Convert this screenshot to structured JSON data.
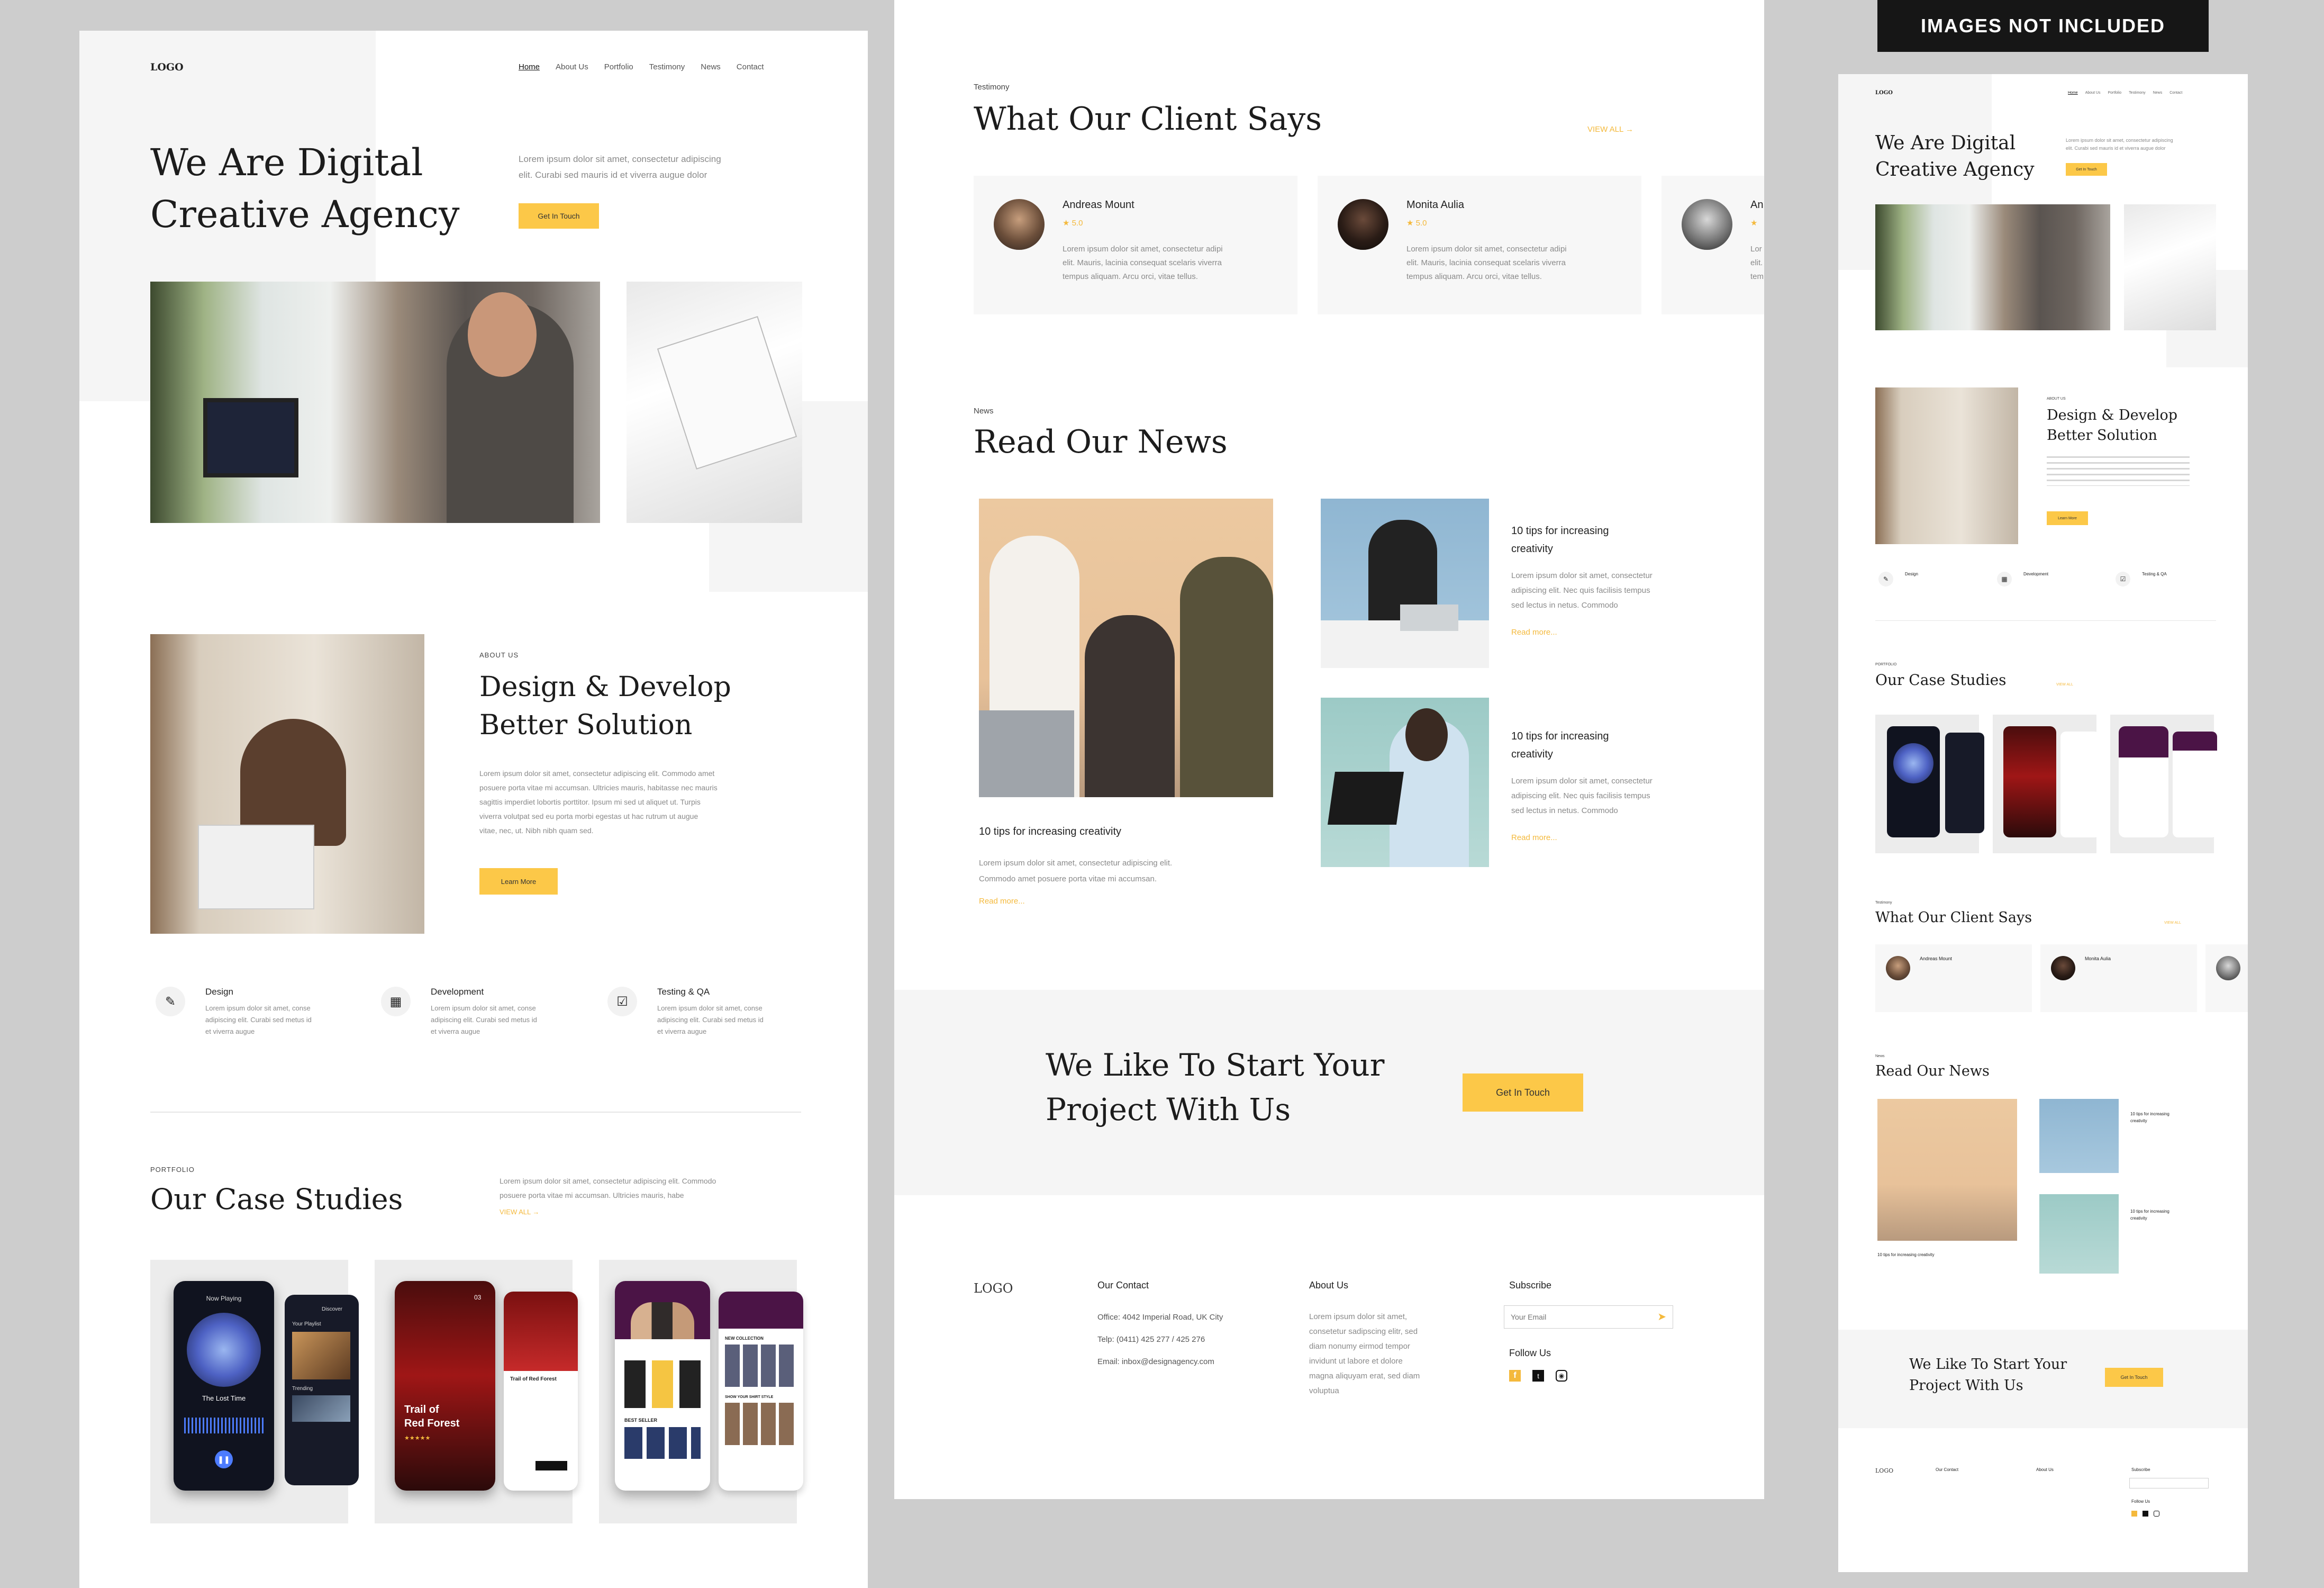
{
  "badge": "IMAGES NOT INCLUDED",
  "colors": {
    "accent": "#fcc848",
    "page_bg": "#cdcdcd",
    "soft_gray": "#f5f5f5",
    "text": "#222222"
  },
  "nav": {
    "logo": "LOGO",
    "items": [
      "Home",
      "About Us",
      "Portfolio",
      "Testimony",
      "News",
      "Contact"
    ]
  },
  "hero": {
    "title": "We Are Digital\nCreative Agency",
    "desc": "Lorem ipsum dolor sit amet, consectetur adipiscing\nelit. Curabi sed mauris id et viverra augue dolor",
    "button": "Get In Touch"
  },
  "about": {
    "label": "ABOUT US",
    "title": "Design & Develop\nBetter Solution",
    "desc": "Lorem ipsum dolor sit amet, consectetur adipiscing elit. Commodo amet\nposuere porta vitae mi accumsan. Ultricies mauris, habitasse nec mauris\nsagittis imperdiet lobortis porttitor. Ipsum mi sed ut aliquet ut. Turpis\nviverra volutpat sed eu porta morbi egestas ut   hac rutrum ut augue\nvitae, nec, ut. Nibh nibh quam sed.",
    "button": "Learn More"
  },
  "services": [
    {
      "icon": "pen-tool-icon",
      "title": "Design",
      "desc": "Lorem ipsum dolor sit amet, conse\nadipiscing elit. Curabi sed metus id\net viverra augue"
    },
    {
      "icon": "grid-icon",
      "title": "Development",
      "desc": "Lorem ipsum dolor sit amet, conse\nadipiscing elit. Curabi sed metus id\net viverra augue"
    },
    {
      "icon": "checkbox-icon",
      "title": "Testing & QA",
      "desc": "Lorem ipsum dolor sit amet, conse\nadipiscing elit. Curabi sed metus id\net viverra augue"
    }
  ],
  "portfolio": {
    "label": "PORTFOLIO",
    "title": "Our Case Studies",
    "desc": "Lorem ipsum dolor sit amet, consectetur adipiscing elit. Commodo\nposuere porta vitae mi accumsan. Ultricies mauris, habe",
    "view_all": "VIEW ALL",
    "card1": {
      "header": "Now Playing",
      "song": "The Lost Time",
      "side1": "Discover",
      "side2": "Your Playlist",
      "side3": "Trending"
    },
    "card2": {
      "title": "Trail of\nRed Forest",
      "sub": "Trail of Red Forest",
      "num": "03"
    },
    "card3": {
      "header": "NEW COLLECTION",
      "sub": "BEST SELLER",
      "shop": "SHOW YOUR SHIRT STYLE"
    }
  },
  "testimony": {
    "label": "Testimony",
    "title": "What Our Client Says",
    "view_all": "VIEW ALL",
    "items": [
      {
        "name": "Andreas Mount",
        "rating": "5.0",
        "text": "Lorem ipsum dolor sit amet, consectetur adipi\nelit. Mauris, lacinia consequat  scelaris  viverra\ntempus aliquam. Arcu orci, vitae tellus."
      },
      {
        "name": "Monita Aulia",
        "rating": "5.0",
        "text": "Lorem ipsum dolor sit amet, consectetur adipi\nelit. Mauris, lacinia consequat  scelaris  viverra\ntempus aliquam. Arcu orci, vitae tellus."
      },
      {
        "name": "An",
        "rating": "",
        "text": "Lor\nelit.\ntem"
      }
    ]
  },
  "news": {
    "label": "News",
    "title": "Read Our News",
    "items": [
      {
        "title": "10 tips for increasing creativity",
        "text": "Lorem ipsum dolor sit amet, consectetur adipiscing elit.\nCommodo amet posuere porta vitae mi accumsan.",
        "more": "Read more..."
      },
      {
        "title": "10 tips for increasing\ncreativity",
        "text": "Lorem ipsum dolor sit amet, consectetur\nadipiscing elit. Nec quis facilisis tempus\nsed lectus in netus. Commodo",
        "more": "Read more..."
      },
      {
        "title": "10 tips for increasing\ncreativity",
        "text": "Lorem ipsum dolor sit amet, consectetur\nadipiscing elit. Nec quis facilisis tempus\nsed lectus in netus. Commodo",
        "more": "Read more..."
      }
    ]
  },
  "cta": {
    "title": "We Like To Start Your\nProject With Us",
    "button": "Get In Touch"
  },
  "footer": {
    "logo": "LOGO",
    "contact_title": "Our Contact",
    "contact_lines": [
      "Office: 4042 Imperial Road, UK City",
      "Telp: (0411) 425 277 / 425 276",
      "Email: inbox@designagency.com"
    ],
    "about_title": "About Us",
    "about_text": "Lorem ipsum dolor sit amet,\nconsetetur sadipscing elitr, sed\ndiam nonumy eirmod tempor\ninvidunt ut labore et dolore\nmagna aliquyam erat, sed diam\nvoluptua",
    "subscribe_title": "Subscribe",
    "email_placeholder": "Your Email",
    "follow_title": "Follow Us"
  }
}
